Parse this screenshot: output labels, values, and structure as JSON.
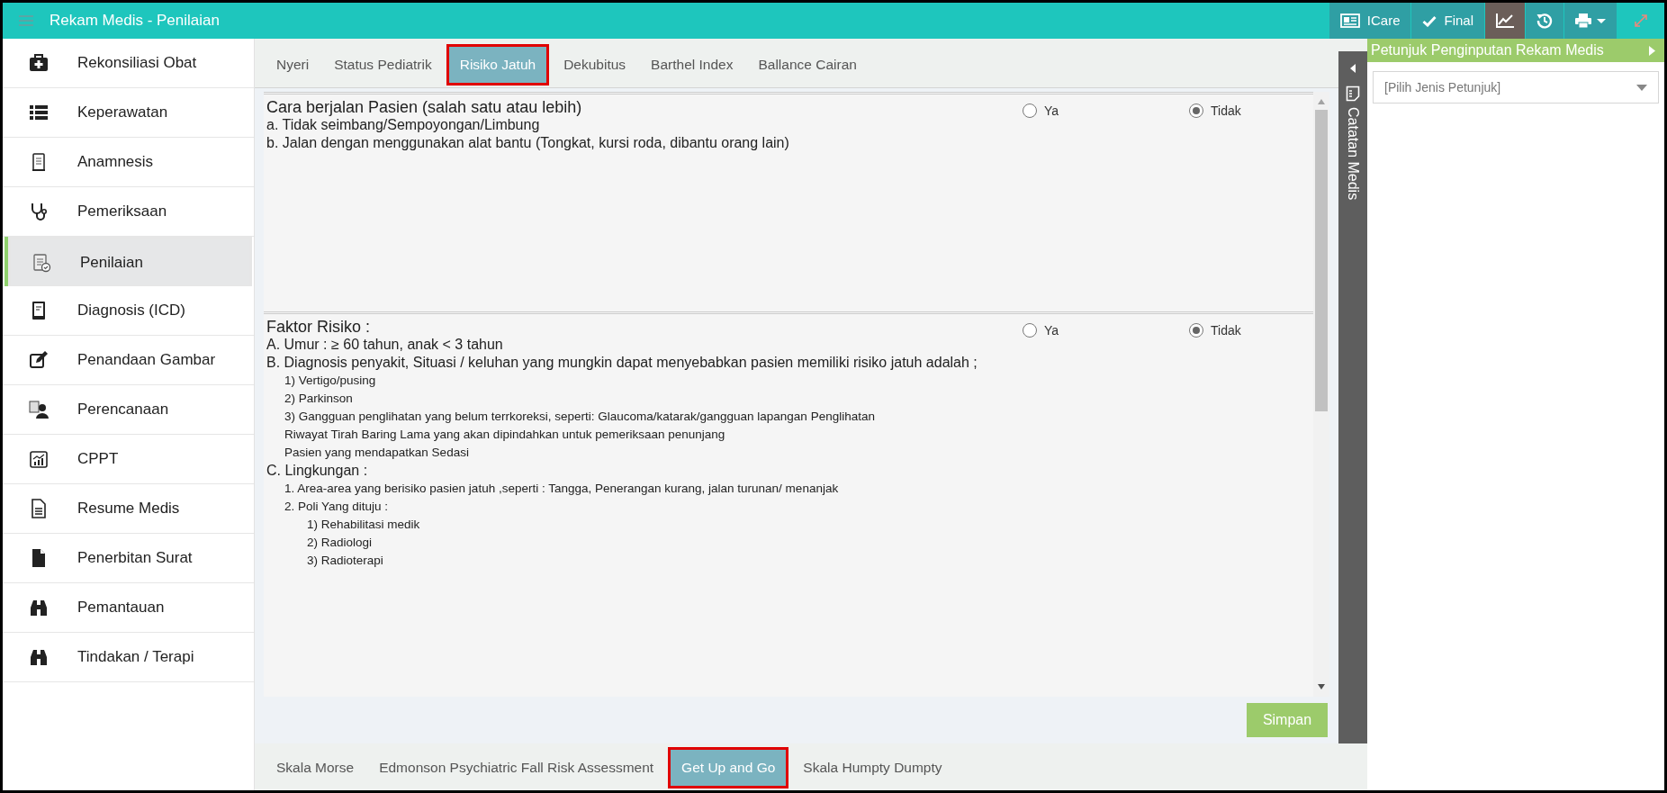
{
  "window": {
    "title": "Rekam Medis - Penilaian"
  },
  "toolbar": [
    {
      "kind": "card",
      "label": "ICare",
      "active": false
    },
    {
      "kind": "check",
      "label": "Final",
      "active": false
    },
    {
      "kind": "chart",
      "active": true
    },
    {
      "kind": "history",
      "active": false
    },
    {
      "kind": "print",
      "active": false
    },
    {
      "kind": "expand",
      "active": false
    }
  ],
  "sidebar": {
    "items": [
      {
        "label": "Rekonsiliasi Obat",
        "selected": false
      },
      {
        "label": "Keperawatan",
        "selected": false
      },
      {
        "label": "Anamnesis",
        "selected": false
      },
      {
        "label": "Pemeriksaan",
        "selected": false
      },
      {
        "label": "Penilaian",
        "selected": true
      },
      {
        "label": "Diagnosis (ICD)",
        "selected": false
      },
      {
        "label": "Penandaan Gambar",
        "selected": false
      },
      {
        "label": "Perencanaan",
        "selected": false
      },
      {
        "label": "CPPT",
        "selected": false
      },
      {
        "label": "Resume Medis",
        "selected": false
      },
      {
        "label": "Penerbitan Surat",
        "selected": false
      },
      {
        "label": "Pemantauan",
        "selected": false
      },
      {
        "label": "Tindakan / Terapi",
        "selected": false
      }
    ]
  },
  "tabs": [
    {
      "label": "Nyeri",
      "selected": false
    },
    {
      "label": "Status Pediatrik",
      "selected": false
    },
    {
      "label": "Risiko Jatuh",
      "selected": true
    },
    {
      "label": "Dekubitus",
      "selected": false
    },
    {
      "label": "Barthel Index",
      "selected": false
    },
    {
      "label": "Ballance Cairan",
      "selected": false
    }
  ],
  "questions": [
    {
      "title": "Cara berjalan Pasien (salah satu atau lebih)",
      "lines": [
        {
          "text": "a. Tidak seimbang/Sempoyongan/Limbung"
        },
        {
          "text": "b. Jalan dengan menggunakan alat bantu (Tongkat, kursi roda, dibantu orang lain)"
        }
      ],
      "options": [
        {
          "label": "Ya",
          "selected": false
        },
        {
          "label": "Tidak",
          "selected": true
        }
      ]
    },
    {
      "title": "Faktor Risiko :",
      "lines": [
        {
          "text": "A. Umur : ≥ 60 tahun, anak < 3 tahun"
        },
        {
          "text": "B. Diagnosis penyakit, Situasi / keluhan yang mungkin dapat menyebabkan pasien memiliki risiko jatuh adalah ;",
          "children": [
            {
              "text": "1) Vertigo/pusing"
            },
            {
              "text": "2) Parkinson"
            },
            {
              "text": "3) Gangguan penglihatan yang belum terrkoreksi, seperti: Glaucoma/katarak/gangguan lapangan Penglihatan"
            },
            {
              "text": "Riwayat Tirah Baring Lama yang akan dipindahkan untuk pemeriksaan penunjang"
            },
            {
              "text": "Pasien yang mendapatkan Sedasi"
            }
          ]
        },
        {
          "text": "C. Lingkungan :",
          "children": [
            {
              "text": "1. Area-area yang berisiko pasien jatuh ,seperti : Tangga, Penerangan kurang, jalan turunan/ menanjak"
            },
            {
              "text": "2. Poli Yang dituju :",
              "children": [
                {
                  "text": "1) Rehabilitasi medik"
                },
                {
                  "text": "2) Radiologi"
                },
                {
                  "text": "3) Radioterapi"
                }
              ]
            }
          ]
        }
      ],
      "options": [
        {
          "label": "Ya",
          "selected": false
        },
        {
          "label": "Tidak",
          "selected": true
        }
      ]
    }
  ],
  "save_button": "Simpan",
  "side_strip": {
    "label": "Catatan Medis"
  },
  "bottom_tabs": [
    {
      "label": "Skala Morse",
      "selected": false
    },
    {
      "label": "Edmonson Psychiatric Fall Risk Assessment",
      "selected": false
    },
    {
      "label": "Get Up and Go",
      "selected": true
    },
    {
      "label": "Skala Humpty Dumpty",
      "selected": false
    }
  ],
  "guide_panel": {
    "title": "Petunjuk Penginputan Rekam Medis",
    "select": {
      "placeholder": "[Pilih Jenis Petunjuk]"
    }
  }
}
